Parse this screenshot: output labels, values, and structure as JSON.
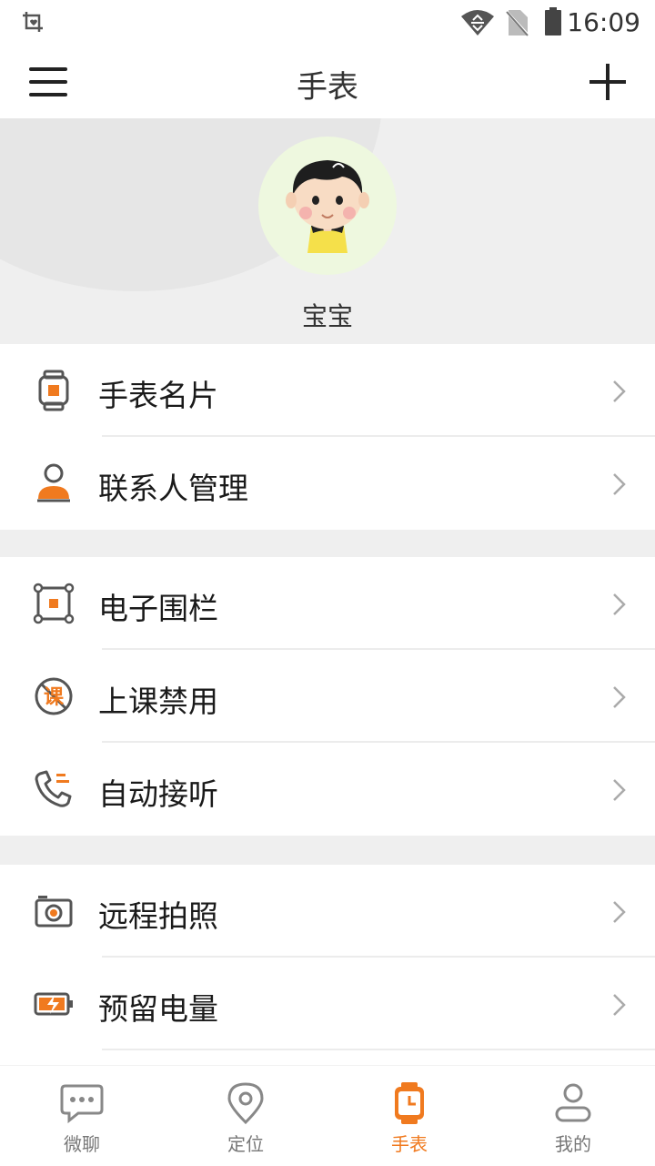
{
  "status_bar": {
    "time": "16:09"
  },
  "header": {
    "title": "手表"
  },
  "profile": {
    "name": "宝宝"
  },
  "sections": [
    {
      "items": [
        {
          "label": "手表名片",
          "icon": "watch-card-icon"
        },
        {
          "label": "联系人管理",
          "icon": "contacts-icon"
        }
      ]
    },
    {
      "items": [
        {
          "label": "电子围栏",
          "icon": "geofence-icon"
        },
        {
          "label": "上课禁用",
          "icon": "class-disable-icon"
        },
        {
          "label": "自动接听",
          "icon": "auto-answer-icon"
        }
      ]
    },
    {
      "items": [
        {
          "label": "远程拍照",
          "icon": "camera-icon"
        },
        {
          "label": "预留电量",
          "icon": "battery-reserve-icon"
        }
      ]
    }
  ],
  "tabs": [
    {
      "label": "微聊",
      "icon": "chat-icon"
    },
    {
      "label": "定位",
      "icon": "location-icon"
    },
    {
      "label": "手表",
      "icon": "watch-icon",
      "active": true
    },
    {
      "label": "我的",
      "icon": "profile-icon"
    }
  ],
  "colors": {
    "accent": "#f07a1f",
    "icon_gray": "#555555",
    "background": "#efefef"
  }
}
